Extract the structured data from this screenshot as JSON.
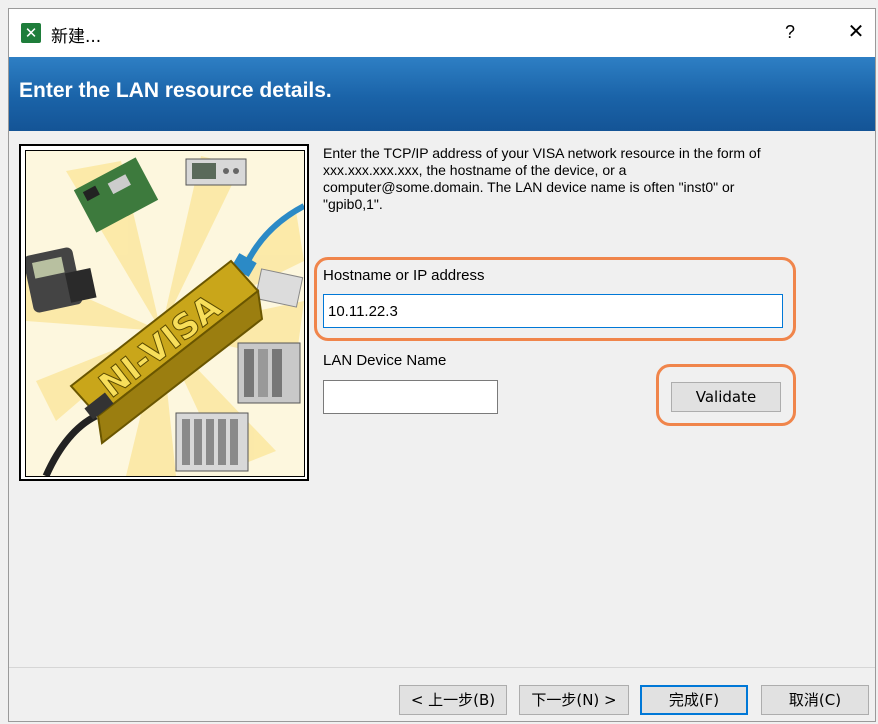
{
  "window": {
    "title": "新建...",
    "help_label": "?",
    "close_label": "✕"
  },
  "banner": {
    "title": "Enter the LAN resource details."
  },
  "illustration": {
    "logo_text": "NI-VISA"
  },
  "instructions": "Enter the TCP/IP address of your VISA network resource in the form of xxx.xxx.xxx.xxx, the hostname of the device, or a computer@some.domain. The LAN device name is often \"inst0\" or \"gpib0,1\".",
  "hostname": {
    "label": "Hostname or IP address",
    "value": "10.11.22.3"
  },
  "lan_device": {
    "label": "LAN Device Name",
    "value": ""
  },
  "buttons": {
    "validate": "Validate",
    "back": "< 上一步(B)",
    "next": "下一步(N) >",
    "finish": "完成(F)",
    "cancel": "取消(C)"
  },
  "colors": {
    "banner": "#1a63a8",
    "highlight": "#f0854b",
    "focus": "#0078d7"
  }
}
